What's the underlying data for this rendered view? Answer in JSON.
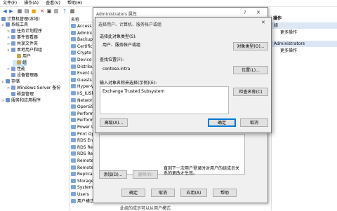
{
  "menu": [
    "文件(F)",
    "操作(A)",
    "查看(V)",
    "帮助(H)"
  ],
  "toolbar_icons": [
    "back-arrow-icon",
    "forward-arrow-icon",
    "up-folder-icon",
    "properties-icon",
    "delete-icon",
    "refresh-icon",
    "export-icon",
    "help-icon",
    "console-icon"
  ],
  "tree": {
    "root": "计算机管理(本地)",
    "items": [
      {
        "label": "系统工具",
        "level": 1,
        "exp": "∨"
      },
      {
        "label": "任务计划程序",
        "level": 2,
        "exp": ">"
      },
      {
        "label": "事件查看器",
        "level": 2,
        "exp": ">"
      },
      {
        "label": "共享文件夹",
        "level": 2,
        "exp": ">"
      },
      {
        "label": "本地用户和组",
        "level": 2,
        "exp": "∨"
      },
      {
        "label": "用户",
        "level": 3,
        "exp": ""
      },
      {
        "label": "组",
        "level": 3,
        "exp": "",
        "selected": true
      },
      {
        "label": "性能",
        "level": 2,
        "exp": ">"
      },
      {
        "label": "设备管理器",
        "level": 2,
        "exp": ""
      },
      {
        "label": "存储",
        "level": 1,
        "exp": "∨"
      },
      {
        "label": "Windows Server 备份",
        "level": 2,
        "exp": ">"
      },
      {
        "label": "磁盘管理",
        "level": 2,
        "exp": ""
      },
      {
        "label": "服务和应用程序",
        "level": 1,
        "exp": ">"
      }
    ]
  },
  "list": {
    "header": "名称",
    "rows": [
      "Access",
      "Admini",
      "Backup",
      "Certific",
      "Crypto",
      "Device",
      "Distribu",
      "Event L",
      "Guests",
      "Hyper-V",
      "IIS_IUSR",
      "Networ",
      "OpenSS",
      "Perform",
      "Perform",
      "Power U",
      "Print Op",
      "RDS En",
      "RDS Re",
      "RDS Re",
      "Remote",
      "Remote",
      "Replica",
      "Storage",
      "System",
      "Users",
      "用户模式硬件设置"
    ],
    "bg_desc": "此组的成员可以从用户模式"
  },
  "actions": {
    "title": "操作",
    "sub1": "组",
    "more1": "更多操作",
    "sub2": "Administrators",
    "more2": "更多操作"
  },
  "bg_dialog": {
    "title": "Administrators 属性",
    "help": "?",
    "close": "✕",
    "add": "添加(D)...",
    "remove": "删除(R)",
    "note": "直到下一次用户登录时对用户的组成员关系的更改才生效。",
    "ok": "确定",
    "cancel": "取消",
    "apply": "应用(A)",
    "help_btn": "帮助"
  },
  "dialog": {
    "title": "选择用户、计算机、服务帐户或组",
    "close": "✕",
    "object_type_label": "选择此对象类型(S):",
    "object_type_value": "用户、服务帐户或组",
    "object_type_btn": "对象类型(O)...",
    "location_label": "查找位置(F):",
    "location_value": "contoso.intra",
    "location_btn": "位置(L)...",
    "names_label": "输入对象名称来选择(示例)(E):",
    "names_value": "Exchange Trusted Subsystem",
    "check_btn": "检查名称(C)",
    "advanced_btn": "高级(A)...",
    "ok_btn": "确定",
    "cancel_btn": "取消"
  },
  "colors": {
    "accent": "#0078d7",
    "selection": "#cce8ff",
    "action_header": "#dce6f4"
  }
}
